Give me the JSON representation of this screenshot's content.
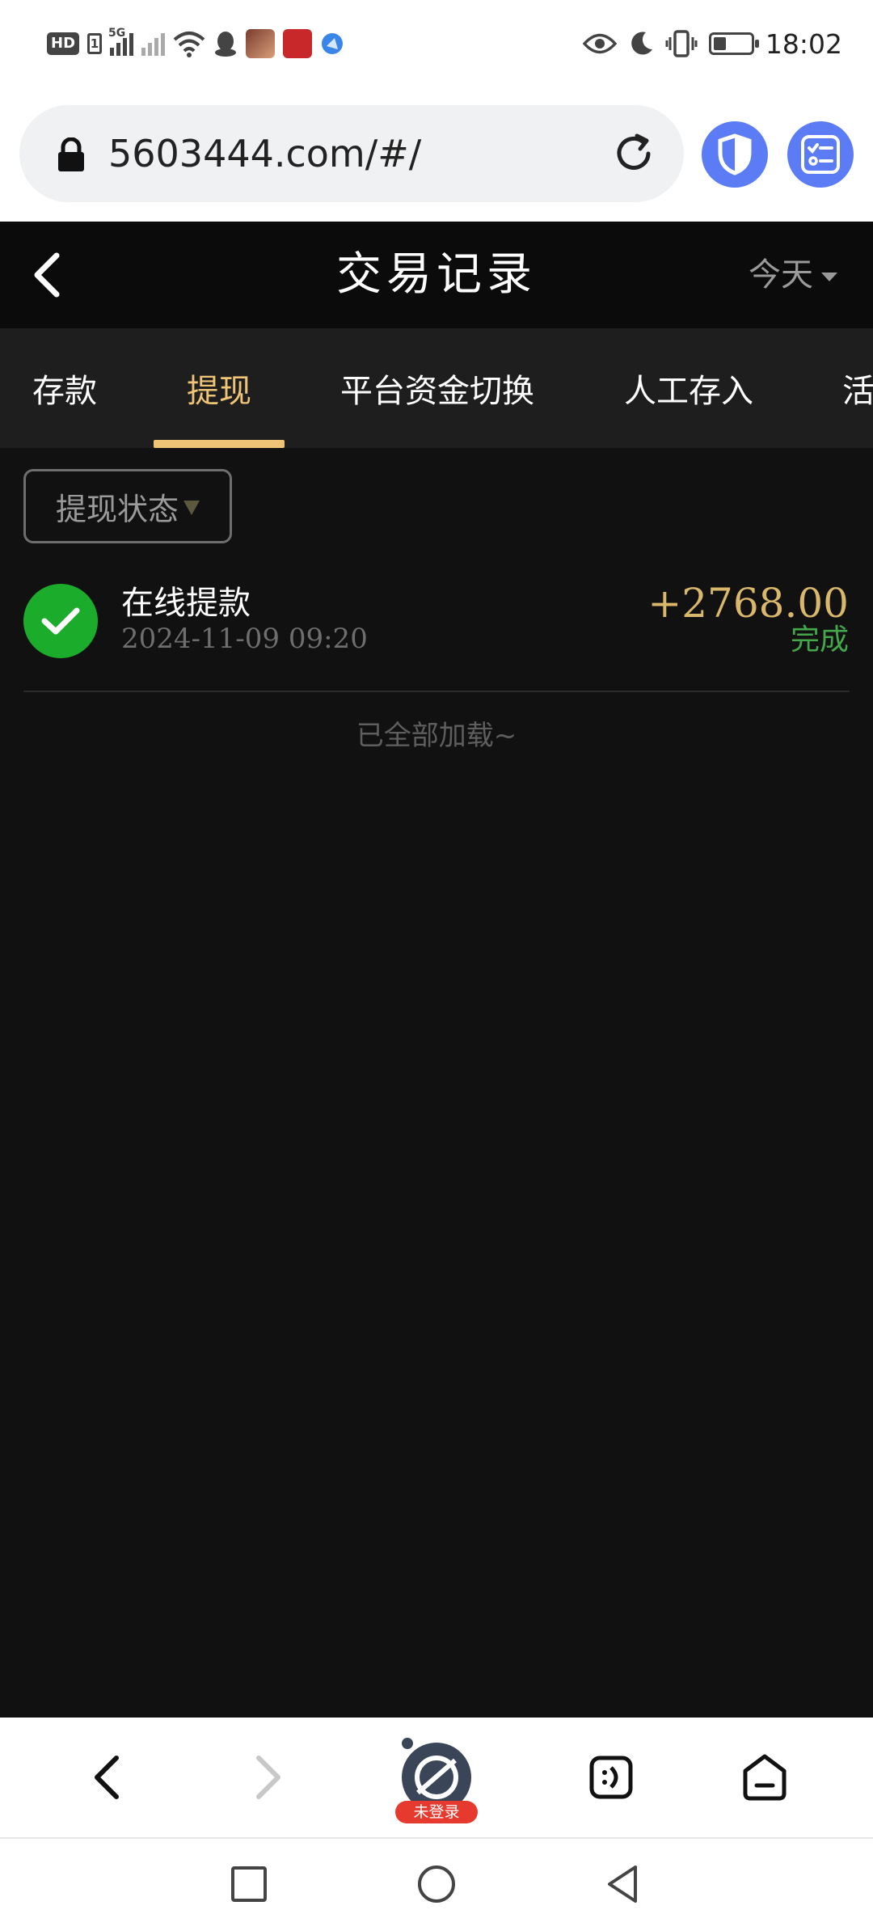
{
  "status_bar": {
    "hd_label": "HD",
    "sim_label": "1",
    "network_type": "5G",
    "time": "18:02",
    "icons": [
      "hd-icon",
      "sim-icon",
      "signal-icon",
      "signal-off-icon",
      "wifi-icon",
      "qq-icon",
      "app-icon",
      "app-icon",
      "browser-icon",
      "eye-icon",
      "moon-icon",
      "vibrate-icon",
      "battery-icon"
    ],
    "battery_level": 0.35
  },
  "browser": {
    "url": "5603444.com/#/",
    "icons": [
      "lock-icon",
      "reload-icon",
      "shield-icon",
      "tasks-icon"
    ]
  },
  "header": {
    "title": "交易记录",
    "date_filter": "今天"
  },
  "tabs": [
    {
      "label": "存款",
      "active": false
    },
    {
      "label": "提现",
      "active": true
    },
    {
      "label": "平台资金切换",
      "active": false
    },
    {
      "label": "人工存入",
      "active": false
    },
    {
      "label": "活",
      "active": false
    }
  ],
  "filter": {
    "label": "提现状态"
  },
  "records": [
    {
      "title": "在线提款",
      "date": "2024-11-09 09:20",
      "amount": "+2768.00",
      "status": "完成"
    }
  ],
  "list_end_text": "已全部加载~",
  "bottom_bar": {
    "login_badge": "未登录",
    "icons": [
      "back-icon",
      "forward-icon",
      "account-icon",
      "tabs-icon",
      "home-icon"
    ]
  },
  "system_nav": {
    "icons": [
      "recents-icon",
      "home-icon",
      "back-icon"
    ]
  },
  "colors": {
    "accent": "#f0c477",
    "amount": "#d9b76b",
    "success": "#1aac2a",
    "status_text": "#44a84a",
    "background": "#111111",
    "browser_blue": "#5b7cf5"
  }
}
